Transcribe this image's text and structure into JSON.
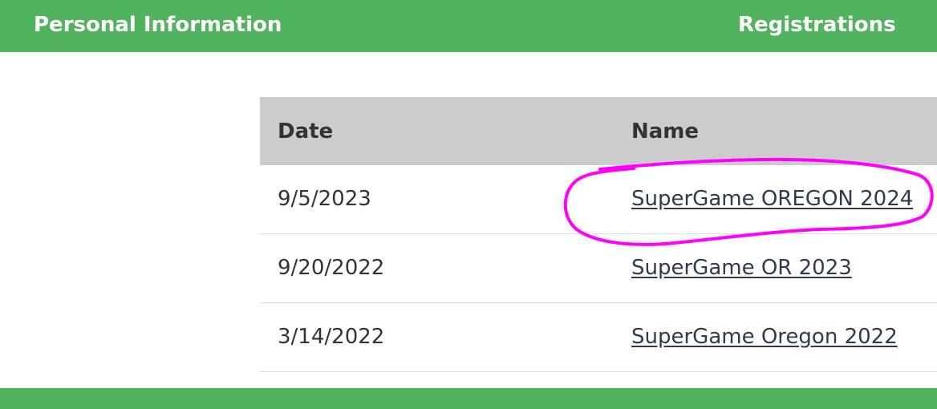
{
  "nav": {
    "tabs": [
      {
        "label": "Personal Information"
      },
      {
        "label": "Registrations"
      }
    ]
  },
  "table": {
    "columns": [
      "Date",
      "Name"
    ],
    "rows": [
      {
        "date": "9/5/2023",
        "name": "SuperGame OREGON 2024"
      },
      {
        "date": "9/20/2022",
        "name": "SuperGame OR 2023"
      },
      {
        "date": "3/14/2022",
        "name": "SuperGame Oregon 2022"
      }
    ]
  },
  "colors": {
    "brand_green": "#52b35e",
    "header_gray": "#cccccc",
    "annotation_magenta": "#ff00ff"
  }
}
